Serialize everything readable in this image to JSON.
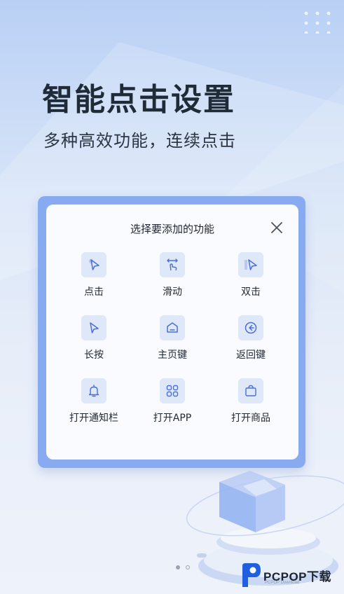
{
  "header": {
    "title": "智能点击设置",
    "subtitle": "多种高效功能，连续点击"
  },
  "dialog": {
    "title": "选择要添加的功能",
    "items": [
      {
        "label": "点击",
        "icon": "cursor-tap-icon"
      },
      {
        "label": "滑动",
        "icon": "swipe-icon"
      },
      {
        "label": "双击",
        "icon": "double-tap-icon"
      },
      {
        "label": "长按",
        "icon": "long-press-icon"
      },
      {
        "label": "主页键",
        "icon": "home-icon"
      },
      {
        "label": "返回键",
        "icon": "back-icon"
      },
      {
        "label": "打开通知栏",
        "icon": "bell-icon"
      },
      {
        "label": "打开APP",
        "icon": "app-grid-icon"
      },
      {
        "label": "打开商品",
        "icon": "shopping-bag-icon"
      }
    ]
  },
  "pager": {
    "current": 1,
    "total": 2
  },
  "watermark": {
    "brand": "PCPOP下载",
    "sub": "PCPOP Download"
  },
  "colors": {
    "accent": "#88aaf0",
    "icon_stroke": "#4a6fd8",
    "icon_bg": "#dfe8f8"
  }
}
